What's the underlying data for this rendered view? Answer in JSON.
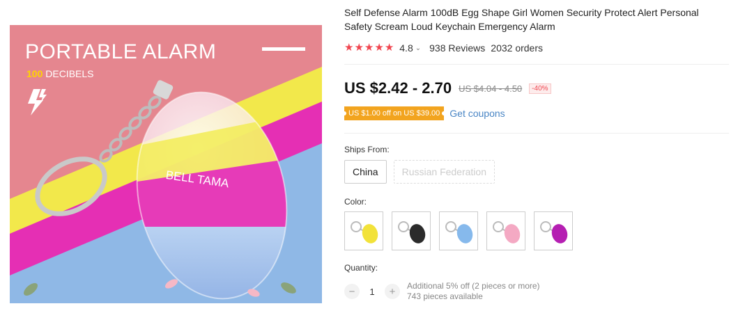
{
  "hero": {
    "title": "PORTABLE ALARM",
    "decibel_num": "100",
    "decibel_label": "DECIBELS",
    "device_text": "BELL TAMA",
    "colors": {
      "pink": "#e5868f",
      "yellow": "#f2e84b",
      "magenta": "#e52fb4",
      "blue": "#8fb8e6"
    }
  },
  "product": {
    "title": "Self Defense Alarm 100dB Egg Shape Girl Women Security Protect Alert Personal Safety Scream Loud Keychain Emergency Alarm"
  },
  "rating": {
    "stars": 5,
    "value": "4.8",
    "caret": "⌄",
    "reviews": "938 Reviews",
    "orders": "2032 orders"
  },
  "price": {
    "current": "US $2.42 - 2.70",
    "original": "US $4.04 - 4.50",
    "discount": "-40%"
  },
  "coupon": {
    "badge": "US $1.00 off on US $39.00",
    "link": "Get coupons"
  },
  "ships": {
    "label": "Ships From:",
    "options": [
      "China",
      "Russian Federation"
    ]
  },
  "color": {
    "label": "Color:",
    "swatches": [
      {
        "name": "yellow",
        "hex": "#f2e23a"
      },
      {
        "name": "black",
        "hex": "#2b2b2b"
      },
      {
        "name": "blue",
        "hex": "#86b9ec"
      },
      {
        "name": "pink",
        "hex": "#f4a9c3"
      },
      {
        "name": "purple",
        "hex": "#b51fb2"
      }
    ]
  },
  "quantity": {
    "label": "Quantity:",
    "minus": "−",
    "value": "1",
    "plus": "+",
    "note1": "Additional 5% off (2 pieces or more)",
    "note2": "743 pieces available"
  }
}
